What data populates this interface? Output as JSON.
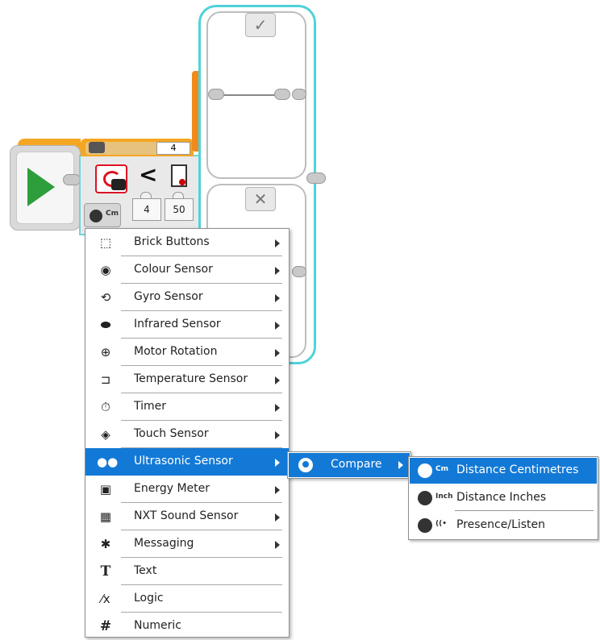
{
  "switch_block": {
    "case_count": "4",
    "case_true_icon": "✓",
    "case_false_icon": "✕",
    "compare_symbol": "<",
    "mode_unit": "Cm",
    "input_compare_type": "4",
    "input_threshold": "50"
  },
  "menu": {
    "items": [
      {
        "label": "Brick Buttons",
        "icon": "brick-buttons-icon",
        "glyph": "⬚",
        "submenu": true
      },
      {
        "label": "Colour Sensor",
        "icon": "colour-sensor-icon",
        "glyph": "◉",
        "submenu": true
      },
      {
        "label": "Gyro Sensor",
        "icon": "gyro-sensor-icon",
        "glyph": "⟲",
        "submenu": true
      },
      {
        "label": "Infrared Sensor",
        "icon": "infrared-sensor-icon",
        "glyph": "⬬",
        "submenu": true
      },
      {
        "label": "Motor Rotation",
        "icon": "motor-rotation-icon",
        "glyph": "⊕",
        "submenu": true
      },
      {
        "label": "Temperature Sensor",
        "icon": "temperature-sensor-icon",
        "glyph": "⊐",
        "submenu": true
      },
      {
        "label": "Timer",
        "icon": "timer-icon",
        "glyph": "⏱",
        "submenu": true
      },
      {
        "label": "Touch Sensor",
        "icon": "touch-sensor-icon",
        "glyph": "◈",
        "submenu": true
      },
      {
        "label": "Ultrasonic Sensor",
        "icon": "ultrasonic-sensor-icon",
        "glyph": "●●",
        "submenu": true,
        "selected": true
      },
      {
        "label": "Energy Meter",
        "icon": "energy-meter-icon",
        "glyph": "▣",
        "submenu": true
      },
      {
        "label": "NXT Sound Sensor",
        "icon": "nxt-sound-sensor-icon",
        "glyph": "▦",
        "submenu": true
      },
      {
        "label": "Messaging",
        "icon": "messaging-icon",
        "glyph": "✱",
        "submenu": true
      },
      {
        "label": "Text",
        "icon": "text-icon",
        "glyph": "T",
        "submenu": false
      },
      {
        "label": "Logic",
        "icon": "logic-icon",
        "glyph": "⁄x",
        "submenu": false
      },
      {
        "label": "Numeric",
        "icon": "numeric-icon",
        "glyph": "#",
        "submenu": false
      }
    ]
  },
  "submenu": {
    "label": "Compare",
    "options": [
      {
        "label": "Distance Centimetres",
        "tag": "Cm",
        "selected": true
      },
      {
        "label": "Distance Inches",
        "tag": "Inch",
        "selected": false
      },
      {
        "label": "Presence/Listen",
        "tag": "((•",
        "selected": false
      }
    ]
  },
  "colors": {
    "highlight": "#1379d6",
    "block_orange": "#f5a623",
    "switch_border": "#4fd2d9",
    "play_green": "#2e9e3c"
  }
}
